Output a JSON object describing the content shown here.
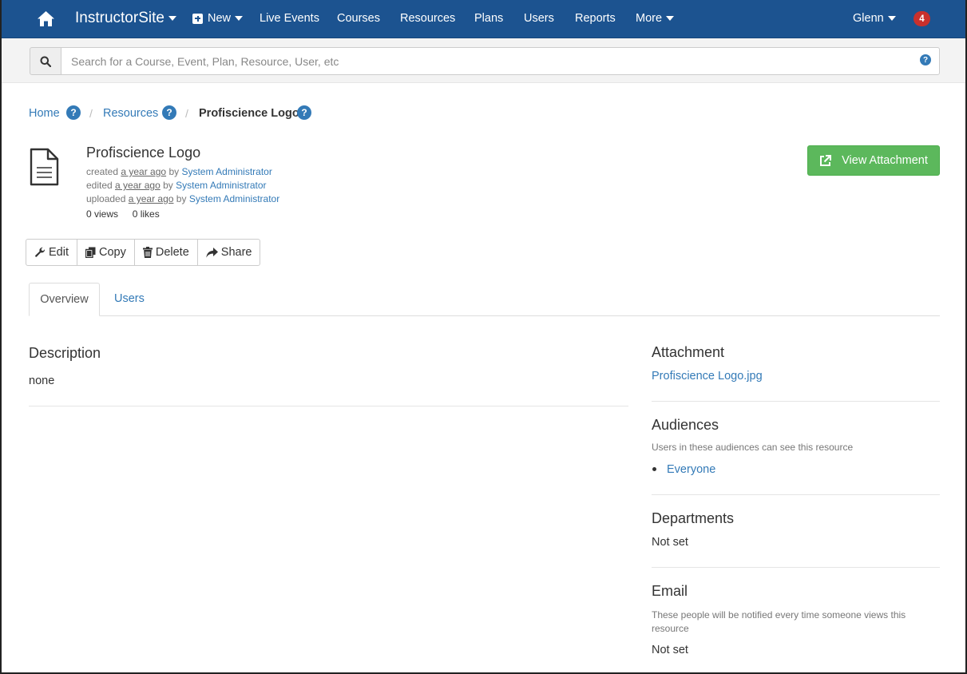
{
  "navbar": {
    "brand": "InstructorSite",
    "new_label": "New",
    "items": [
      "Live Events",
      "Courses",
      "Resources",
      "Plans",
      "Users",
      "Reports"
    ],
    "more_label": "More",
    "user_label": "Glenn",
    "notification_count": "4"
  },
  "search": {
    "placeholder": "Search for a Course, Event, Plan, Resource, User, etc",
    "help_glyph": "?"
  },
  "breadcrumb": {
    "home": "Home",
    "resources": "Resources",
    "current": "Profiscience Logo",
    "separator": "/",
    "help_glyph": "?"
  },
  "resource": {
    "title": "Profiscience Logo",
    "created_prefix": "created",
    "edited_prefix": "edited",
    "uploaded_prefix": "uploaded",
    "ago": "a year ago",
    "by": "by",
    "author": "System Administrator",
    "views": "0 views",
    "likes": "0 likes"
  },
  "view_attachment_label": "View Attachment",
  "actions": {
    "edit": "Edit",
    "copy": "Copy",
    "delete": "Delete",
    "share": "Share"
  },
  "tabs": {
    "overview": "Overview",
    "users": "Users"
  },
  "description": {
    "heading": "Description",
    "value": "none"
  },
  "sidebar": {
    "attachment_heading": "Attachment",
    "attachment_file": "Profiscience Logo.jpg",
    "audiences_heading": "Audiences",
    "audiences_help": "Users in these audiences can see this resource",
    "audience_item": "Everyone",
    "departments_heading": "Departments",
    "departments_value": "Not set",
    "email_heading": "Email",
    "email_help": "These people will be notified every time someone views this resource",
    "email_value": "Not set"
  },
  "colors": {
    "navbar": "#1c5390",
    "link": "#337ab7",
    "success": "#5cb85c",
    "badge": "#c9302c"
  },
  "icons": [
    "home-icon",
    "plus-square-icon",
    "search-icon",
    "question-circle-icon",
    "file-text-icon",
    "external-link-icon",
    "wrench-icon",
    "copy-icon",
    "trash-icon",
    "share-icon"
  ]
}
